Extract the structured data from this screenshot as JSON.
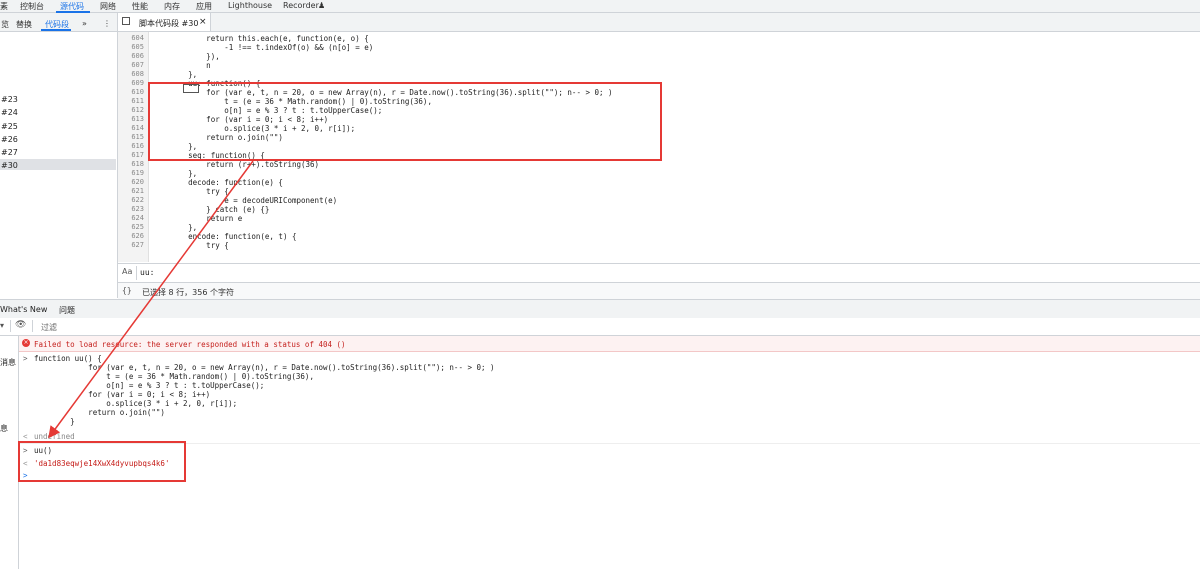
{
  "top_tabs": [
    "素",
    "控制台",
    "源代码",
    "网络",
    "性能",
    "内存",
    "应用",
    "Lighthouse",
    "Recorder"
  ],
  "sidebar": {
    "tabs": [
      "览",
      "替换",
      "代码段"
    ],
    "more": "»",
    "menu": "⋮",
    "snippets": [
      "#23",
      "#24",
      "#25",
      "#26",
      "#27",
      "#30"
    ]
  },
  "editor": {
    "tab_title": "脚本代码段 #30",
    "close": "×",
    "line_numbers": [
      "604",
      "605",
      "606",
      "607",
      "608",
      "609",
      "610",
      "611",
      "612",
      "613",
      "614",
      "615",
      "616",
      "617",
      "618",
      "619",
      "620",
      "621",
      "622",
      "623",
      "624",
      "625",
      "626",
      "627"
    ],
    "lines": [
      "            return this.each(e, function(e, o) {",
      "                -1 !== t.indexOf(o) && (n[o] = e)",
      "            }),",
      "            n",
      "        },",
      "        uu: function() {",
      "            for (var e, t, n = 20, o = new Array(n), r = Date.now().toString(36).split(\"\"); n-- > 0; )",
      "                t = (e = 36 * Math.random() | 0).toString(36),",
      "                o[n] = e % 3 ? t : t.toUpperCase();",
      "            for (var i = 0; i < 8; i++)",
      "                o.splice(3 * i + 2, 0, r[i]);",
      "            return o.join(\"\")",
      "        },",
      "        seq: function() {",
      "            return (r++).toString(36)",
      "        },",
      "        decode: function(e) {",
      "            try {",
      "                e = decodeURIComponent(e)",
      "            } catch (e) {}",
      "            return e",
      "        },",
      "        encode: function(e, t) {",
      "            try {"
    ],
    "search_value": "uu:",
    "status_braces": "{}",
    "status_text": "已选择 8 行，356 个字符"
  },
  "drawer": {
    "tabs": [
      "What's New",
      "问题"
    ],
    "filter_placeholder": "过滤"
  },
  "console": {
    "left_labels": [
      "消息",
      "息"
    ],
    "error": "Failed to load resource: the server responded with a status of 404 ()",
    "input_prompt": ">",
    "output_prompt": "<",
    "fn_lines": [
      "function uu() {",
      "            for (var e, t, n = 20, o = new Array(n), r = Date.now().toString(36).split(\"\"); n-- > 0; )",
      "                t = (e = 36 * Math.random() | 0).toString(36),",
      "                o[n] = e % 3 ? t : t.toUpperCase();",
      "            for (var i = 0; i < 8; i++)",
      "                o.splice(3 * i + 2, 0, r[i]);",
      "            return o.join(\"\")",
      "        }"
    ],
    "undefined_text": "undefined",
    "call": "uu()",
    "result": "'da1d83eqwje14XwX4dyvupbqs4k6'"
  },
  "colors": {
    "annotation_red": "#e53935",
    "accent_blue": "#1a73e8"
  }
}
